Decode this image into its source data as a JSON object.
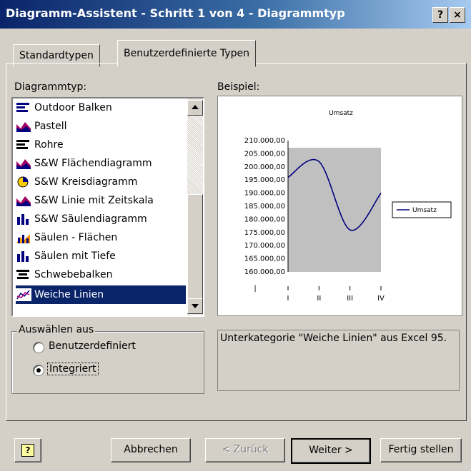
{
  "window": {
    "title": "Diagramm-Assistent - Schritt 1 von 4 - Diagrammtyp",
    "help_btn": "?",
    "close_btn": "×"
  },
  "tabs": [
    {
      "label": "Standardtypen"
    },
    {
      "label": "Benutzerdefinierte Typen"
    }
  ],
  "list": {
    "label": "Diagrammtyp:",
    "items": [
      {
        "label": "Outdoor Balken",
        "icon": "bar-chart-icon"
      },
      {
        "label": "Pastell",
        "icon": "area-chart-icon"
      },
      {
        "label": "Rohre",
        "icon": "bar-chart-icon"
      },
      {
        "label": "S&W Flächendiagramm",
        "icon": "area-chart-icon"
      },
      {
        "label": "S&W Kreisdiagramm",
        "icon": "pie-chart-icon"
      },
      {
        "label": "S&W Linie mit Zeitskala",
        "icon": "area-chart-icon"
      },
      {
        "label": "S&W Säulendiagramm",
        "icon": "column-chart-icon"
      },
      {
        "label": "Säulen - Flächen",
        "icon": "column-area-chart-icon"
      },
      {
        "label": "Säulen mit Tiefe",
        "icon": "column-chart-icon"
      },
      {
        "label": "Schwebebalken",
        "icon": "bar-chart-icon"
      },
      {
        "label": "Weiche Linien",
        "icon": "line-chart-icon",
        "selected": true
      }
    ]
  },
  "preview": {
    "label": "Beispiel:"
  },
  "chart_data": {
    "type": "line",
    "title": "Umsatz",
    "categories": [
      "I",
      "II",
      "III",
      "IV"
    ],
    "series": [
      {
        "name": "Umsatz",
        "values": [
          196000,
          202000,
          176000,
          190000
        ]
      }
    ],
    "ylim": [
      160000,
      210000
    ],
    "yticks": [
      "210.000,00",
      "205.000,00",
      "200.000,00",
      "195.000,00",
      "190.000,00",
      "185.000,00",
      "180.000,00",
      "175.000,00",
      "170.000,00",
      "165.000,00",
      "160.000,00"
    ],
    "smooth": true,
    "plot_background": "#c0c0c0",
    "legend": "right"
  },
  "group": {
    "title": "Auswählen aus",
    "options": [
      {
        "label": "Benutzerdefiniert",
        "checked": false
      },
      {
        "label": "Integriert",
        "checked": true
      }
    ]
  },
  "description": "Unterkategorie \"Weiche Linien\" aus Excel 95.",
  "buttons": {
    "help": "?",
    "cancel": "Abbrechen",
    "back": "< Zurück",
    "next": "Weiter >",
    "finish": "Fertig stellen"
  },
  "colors": {
    "title_bar": "#0a246a",
    "selection": "#0a246a",
    "face": "#d4d0c8"
  }
}
